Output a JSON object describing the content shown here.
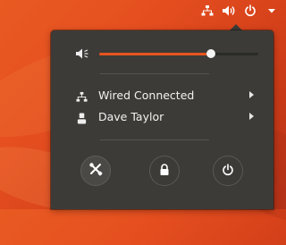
{
  "top_panel": {
    "icons": [
      "network-wired-icon",
      "volume-icon",
      "power-icon",
      "dropdown-arrow-icon"
    ]
  },
  "menu": {
    "volume": {
      "icon": "speaker-icon",
      "level": 0.7
    },
    "items": [
      {
        "label": "Wired Connected",
        "icon": "network-wired-icon"
      },
      {
        "label": "Dave Taylor",
        "icon": "user-icon"
      }
    ],
    "actions": [
      {
        "name": "settings",
        "icon": "tools-icon"
      },
      {
        "name": "lock",
        "icon": "lock-icon"
      },
      {
        "name": "power-off",
        "icon": "power-icon"
      }
    ]
  },
  "colors": {
    "accent": "#e95420",
    "menu_bg": "#3c3b37",
    "text": "#f2f2f2"
  }
}
